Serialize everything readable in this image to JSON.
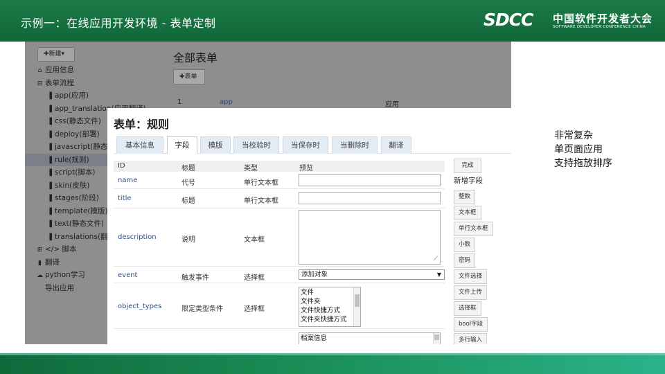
{
  "slide": {
    "title": "示例一：在线应用开发环境 - 表单定制",
    "logo": {
      "mark": "SDCC",
      "cn": "中国软件开发者大会",
      "en": "SOFTWARE DEVELOPER CONFERENCE CHINA"
    },
    "notes": [
      "非常复杂",
      "单页面应用",
      "支持拖放排序"
    ]
  },
  "background": {
    "new_button": "✚新建▾",
    "tree": [
      {
        "label": "应用信息",
        "icon": "home-icon",
        "glyph": "⌂",
        "level": 0
      },
      {
        "label": "表单流程",
        "icon": "collapse-folder-icon",
        "glyph": "⊟",
        "level": 0
      },
      {
        "label": "app(应用)",
        "icon": "file-icon",
        "glyph": "▐",
        "level": 1
      },
      {
        "label": "app_translation(应用翻译)",
        "icon": "file-icon",
        "glyph": "▐",
        "level": 1
      },
      {
        "label": "css(静态文件)",
        "icon": "file-icon",
        "glyph": "▐",
        "level": 1
      },
      {
        "label": "deploy(部署)",
        "icon": "file-icon",
        "glyph": "▐",
        "level": 1
      },
      {
        "label": "javascript(静态",
        "icon": "file-icon",
        "glyph": "▐",
        "level": 1
      },
      {
        "label": "rule(规则)",
        "icon": "file-icon",
        "glyph": "▐",
        "level": 1,
        "selected": true
      },
      {
        "label": "script(脚本)",
        "icon": "file-icon",
        "glyph": "▐",
        "level": 1
      },
      {
        "label": "skin(皮肤)",
        "icon": "file-icon",
        "glyph": "▐",
        "level": 1
      },
      {
        "label": "stages(阶段)",
        "icon": "file-icon",
        "glyph": "▐",
        "level": 1
      },
      {
        "label": "template(模版)",
        "icon": "file-icon",
        "glyph": "▐",
        "level": 1
      },
      {
        "label": "text(静态文件)",
        "icon": "file-icon",
        "glyph": "▐",
        "level": 1
      },
      {
        "label": "translations(翻",
        "icon": "file-icon",
        "glyph": "▐",
        "level": 1
      },
      {
        "label": "</> 脚本",
        "icon": "expand-folder-icon",
        "glyph": "⊞",
        "level": 0
      },
      {
        "label": "翻译",
        "icon": "mic-icon",
        "glyph": "▮",
        "level": 0
      },
      {
        "label": "python学习",
        "icon": "cloud-icon",
        "glyph": "☁",
        "level": 0
      },
      {
        "label": "导出应用",
        "icon": "",
        "glyph": "",
        "level": 0
      }
    ],
    "main_title": "全部表单",
    "form_button": "✚表单",
    "first_row": {
      "num": "1",
      "link": "app",
      "col": "应用"
    }
  },
  "modal": {
    "title": "表单：规则",
    "tabs": [
      "基本信息",
      "字段",
      "模版",
      "当校验时",
      "当保存时",
      "当删除时",
      "翻译"
    ],
    "active_tab": 1,
    "headers": {
      "id": "ID",
      "title": "标题",
      "type": "类型",
      "preview": "预览"
    },
    "rows": [
      {
        "id": "name",
        "title": "代号",
        "type": "单行文本框"
      },
      {
        "id": "title",
        "title": "标题",
        "type": "单行文本框"
      },
      {
        "id": "description",
        "title": "说明",
        "type": "文本框"
      },
      {
        "id": "event",
        "title": "触发事件",
        "type": "选择框",
        "selected": "添加对象"
      },
      {
        "id": "object_types",
        "title": "限定类型条件",
        "type": "选择框",
        "options": [
          "文件",
          "文件夹",
          "文件快捷方式",
          "文件夹快捷方式"
        ]
      },
      {
        "id": "",
        "title": "",
        "type": "",
        "options": [
          "档案信息"
        ]
      }
    ],
    "done_button": "完成",
    "new_field_label": "新增字段",
    "field_types": [
      "整数",
      "文本框",
      "单行文本框",
      "小数",
      "密码",
      "文件选择",
      "文件上传",
      "选择框",
      "bool字段",
      "多行输入"
    ]
  }
}
